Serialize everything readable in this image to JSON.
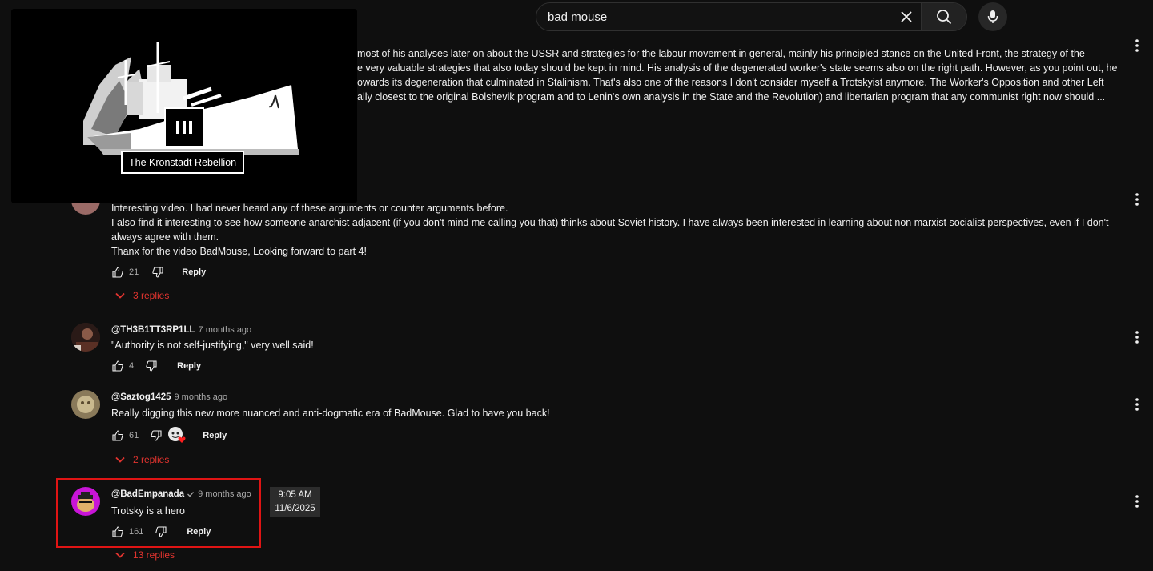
{
  "search": {
    "query": "bad mouse",
    "clear_icon": "close-icon",
    "search_icon": "search-icon",
    "mic_icon": "mic-icon"
  },
  "miniplayer": {
    "caption": "The Kronstadt Rebellion",
    "pause_icon": "pause-icon"
  },
  "comments": [
    {
      "id": "top-truncated",
      "lines": [
        "most of his analyses later on about the USSR and strategies for the labour movement in general, mainly his principled stance on the United Front, the strategy of the",
        "e very valuable strategies that also today should be kept in mind. His analysis of the degenerated worker's state seems also on the right path. However, as you point out, he",
        "owards its degeneration that culminated in Stalinism. That's also one of the reasons I don't consider myself a Trotskyist anymore. The Worker's Opposition and other Left",
        "ally closest to the original Bolshevik program and to Lenin's own analysis in the State and the Revolution) and libertarian program that any communist right now should ..."
      ]
    },
    {
      "id": "interesting-video",
      "lines": [
        "Interesting video. I had never heard any of these arguments or counter arguments before.",
        "I also find it interesting to see how someone anarchist adjacent (if you don't mind me calling you that) thinks about Soviet history. I have always been interested in learning about non marxist socialist perspectives, even if I don't",
        "always agree with them.",
        "Thanx for the video BadMouse, Looking forward to part 4!"
      ],
      "likes": "21",
      "reply_label": "Reply",
      "replies": "3 replies"
    },
    {
      "id": "th3b1tt3rp1ll",
      "author": "@TH3B1TT3RP1LL",
      "time": "7 months ago",
      "text": "\"Authority is not self-justifying,\" very well said!",
      "likes": "4",
      "reply_label": "Reply"
    },
    {
      "id": "saztog1425",
      "author": "@Saztog1425",
      "time": "9 months ago",
      "text": "Really digging this new more nuanced and anti-dogmatic era of BadMouse. Glad to have you back!",
      "likes": "61",
      "reply_label": "Reply",
      "replies": "2 replies"
    },
    {
      "id": "badempanada",
      "author": "@BadEmpanada",
      "verified_icon": "checkmark-icon",
      "time": "9 months ago",
      "text": "Trotsky is a hero",
      "likes": "161",
      "reply_label": "Reply",
      "replies": "13 replies"
    }
  ],
  "tooltip": {
    "time": "9:05 AM",
    "date": "11/6/2025"
  },
  "colors": {
    "background": "#0f0f0f",
    "replies_red": "#e3342f",
    "highlight": "#e01414"
  }
}
